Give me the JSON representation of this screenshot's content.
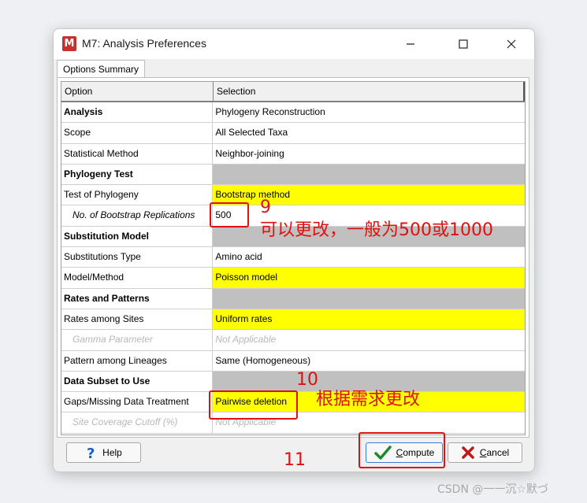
{
  "window": {
    "title": "M7: Analysis Preferences",
    "icon_letter": "M",
    "accent": "#c8302b"
  },
  "tab": {
    "label": "Options Summary"
  },
  "table": {
    "headers": [
      "Option",
      "Selection"
    ],
    "rows": [
      {
        "option": "Analysis",
        "selection": "Phylogeny Reconstruction"
      },
      {
        "option": "Scope",
        "selection": "All Selected Taxa"
      },
      {
        "option": "Statistical Method",
        "selection": "Neighbor-joining"
      },
      {
        "option": "Phylogeny Test",
        "selection": ""
      },
      {
        "option": "Test of Phylogeny",
        "selection": "Bootstrap method"
      },
      {
        "option": "No. of Bootstrap Replications",
        "selection": "500"
      },
      {
        "option": "Substitution Model",
        "selection": ""
      },
      {
        "option": "Substitutions Type",
        "selection": "Amino acid"
      },
      {
        "option": "Model/Method",
        "selection": "Poisson model"
      },
      {
        "option": "Rates and Patterns",
        "selection": ""
      },
      {
        "option": "Rates among Sites",
        "selection": "Uniform rates"
      },
      {
        "option": "Gamma Parameter",
        "selection": "Not Applicable"
      },
      {
        "option": "Pattern among Lineages",
        "selection": "Same (Homogeneous)"
      },
      {
        "option": "Data Subset to Use",
        "selection": ""
      },
      {
        "option": "Gaps/Missing Data Treatment",
        "selection": "Pairwise deletion"
      },
      {
        "option": "Site Coverage Cutoff (%)",
        "selection": "Not Applicable"
      }
    ]
  },
  "buttons": {
    "help": "Help",
    "compute_pre": "",
    "compute_ul": "C",
    "compute_post": "ompute",
    "cancel_pre": "",
    "cancel_ul": "C",
    "cancel_post": "ancel"
  },
  "annotations": {
    "num9": "9",
    "text9": "可以更改，一般为500或1000",
    "num10": "10",
    "text10": "根据需求更改",
    "num11": "11",
    "color": "#e01010"
  },
  "watermark": "CSDN @一一沉☆默づ"
}
